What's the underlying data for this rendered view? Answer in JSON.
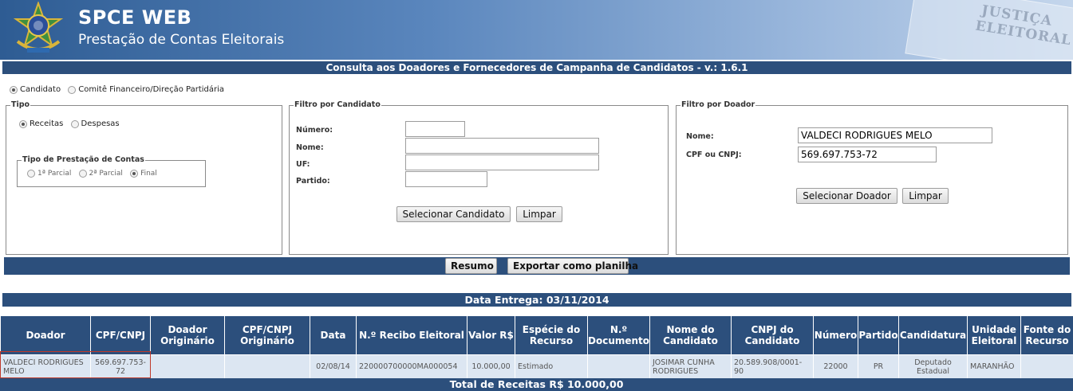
{
  "header": {
    "title": "SPCE WEB",
    "subtitle": "Prestação de Contas Eleitorais",
    "watermark_line1": "JUSTIÇA",
    "watermark_line2": "ELEITORAL"
  },
  "title_bar": "Consulta aos Doadores e Fornecedores de Campanha de Candidatos - v.: 1.6.1",
  "top_radios": [
    {
      "label": "Candidato",
      "checked": true
    },
    {
      "label": "Comitê Financeiro/Direção Partidária",
      "checked": false
    }
  ],
  "tipo": {
    "legend": "Tipo",
    "options": [
      {
        "label": "Receitas",
        "checked": true
      },
      {
        "label": "Despesas",
        "checked": false
      }
    ],
    "prestacao": {
      "legend": "Tipo de Prestação de Contas",
      "options": [
        {
          "label": "1ª Parcial",
          "checked": false
        },
        {
          "label": "2ª Parcial",
          "checked": false
        },
        {
          "label": "Final",
          "checked": true
        }
      ]
    }
  },
  "filtro_candidato": {
    "legend": "Filtro por Candidato",
    "numero_label": "Número:",
    "nome_label": "Nome:",
    "uf_label": "UF:",
    "partido_label": "Partido:",
    "numero_value": "",
    "nome_value": "",
    "uf_value": "",
    "partido_value": "",
    "select_button": "Selecionar Candidato",
    "clear_button": "Limpar"
  },
  "filtro_doador": {
    "legend": "Filtro por Doador",
    "nome_label": "Nome:",
    "cpf_label": "CPF ou CNPJ:",
    "nome_value": "VALDECI RODRIGUES MELO",
    "cpf_value": "569.697.753-72",
    "select_button": "Selecionar Doador",
    "clear_button": "Limpar"
  },
  "actions": {
    "resumo": "Resumo",
    "exportar": "Exportar como planilha"
  },
  "data_entrega": "Data Entrega: 03/11/2014",
  "table": {
    "headers": [
      "Doador",
      "CPF/CNPJ",
      "Doador Originário",
      "CPF/CNPJ Originário",
      "Data",
      "N.º Recibo Eleitoral",
      "Valor R$",
      "Espécie do Recurso",
      "N.º Documento",
      "Nome do Candidato",
      "CNPJ do Candidato",
      "Número",
      "Partido",
      "Candidatura",
      "Unidade Eleitoral",
      "Fonte do Recurso"
    ],
    "rows": [
      [
        "VALDECI RODRIGUES MELO",
        "569.697.753-72",
        "",
        "",
        "02/08/14",
        "220000700000MA000054",
        "10.000,00",
        "Estimado",
        "",
        "JOSIMAR CUNHA RODRIGUES",
        "20.589.908/0001-90",
        "22000",
        "PR",
        "Deputado Estadual",
        "MARANHÃO",
        ""
      ]
    ],
    "total": "Total de Receitas R$ 10.000,00"
  }
}
